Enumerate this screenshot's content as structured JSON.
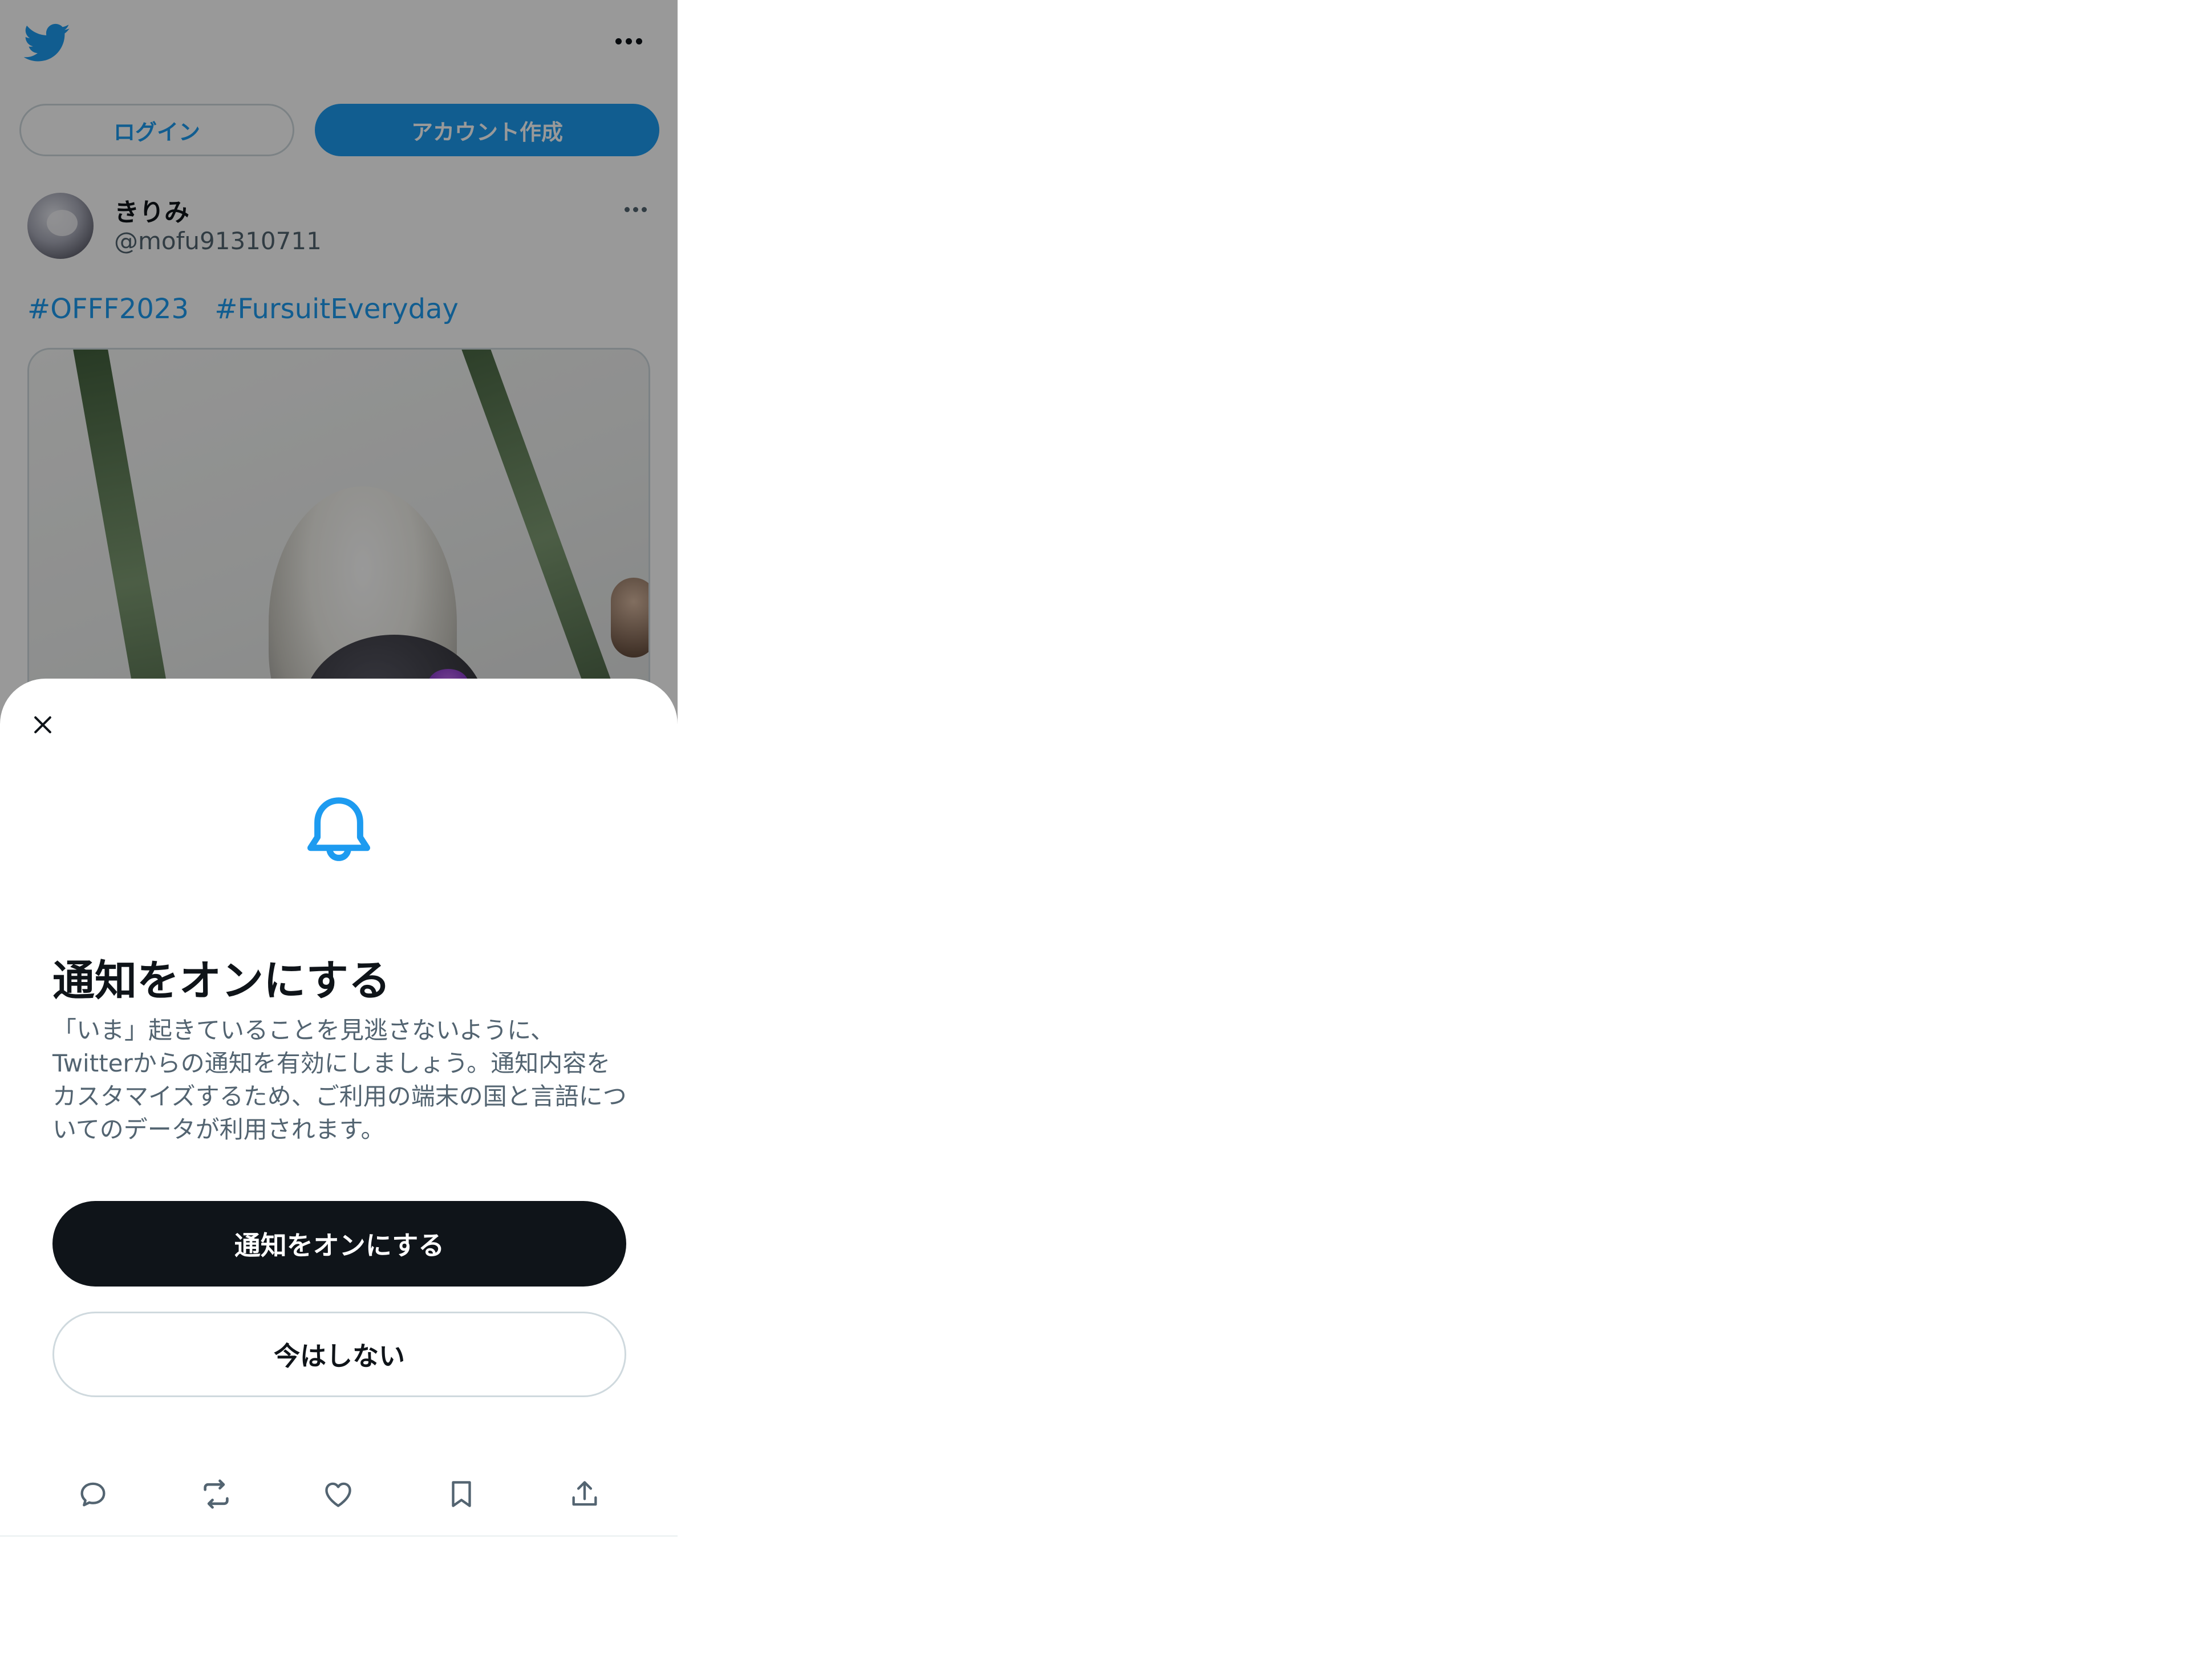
{
  "header": {
    "logo_icon": "twitter-bird-icon",
    "more_icon": "more-horizontal-icon",
    "login_label": "ログイン",
    "signup_label": "アカウント作成"
  },
  "tweet": {
    "display_name": "きりみ",
    "handle": "@mofu91310711",
    "hashtags": [
      "#OFFF2023",
      "#FursuitEveryday"
    ],
    "more_icon": "more-horizontal-icon"
  },
  "sheet": {
    "close_icon": "close-icon",
    "bell_icon": "bell-icon",
    "title": "通知をオンにする",
    "description": "「いま」起きていることを見逃さないように、Twitterからの通知を有効にしましょう。通知内容をカスタマイズするため、ご利用の端末の国と言語についてのデータが利用されます。",
    "primary_button": "通知をオンにする",
    "secondary_button": "今はしない"
  },
  "actions": [
    "reply-icon",
    "retweet-icon",
    "like-icon",
    "bookmark-icon",
    "share-icon"
  ],
  "colors": {
    "accent": "#1d9bf0",
    "text": "#0f1419",
    "secondary_text": "#536471",
    "border": "#cfd9de"
  }
}
